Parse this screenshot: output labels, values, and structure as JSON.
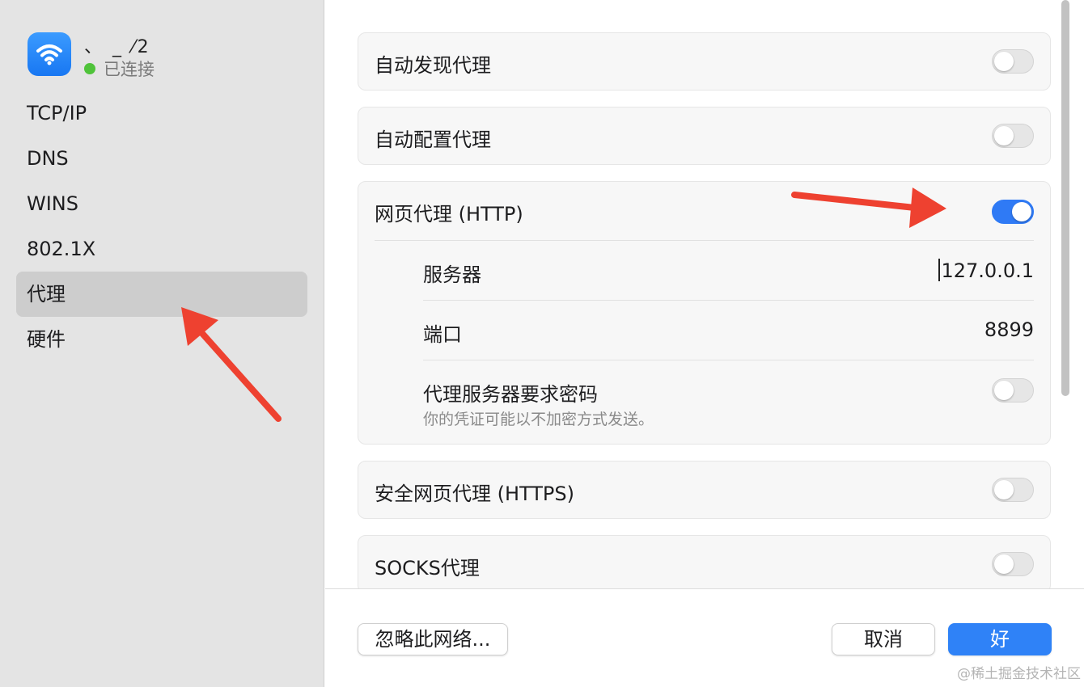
{
  "network": {
    "name": "、 _ ⁄2",
    "status": "已连接"
  },
  "sidebar": {
    "items": [
      {
        "label": "TCP/IP"
      },
      {
        "label": "DNS"
      },
      {
        "label": "WINS"
      },
      {
        "label": "802.1X"
      },
      {
        "label": "代理"
      },
      {
        "label": "硬件"
      }
    ],
    "selected": "代理"
  },
  "proxies": {
    "auto_discovery": {
      "label": "自动发现代理",
      "enabled": false
    },
    "auto_config": {
      "label": "自动配置代理",
      "enabled": false
    },
    "http": {
      "label": "网页代理 (HTTP)",
      "enabled": true,
      "server_label": "服务器",
      "server_value": "127.0.0.1",
      "port_label": "端口",
      "port_value": "8899",
      "auth_label": "代理服务器要求密码",
      "auth_note": "你的凭证可能以不加密方式发送。",
      "auth_enabled": false
    },
    "https": {
      "label": "安全网页代理 (HTTPS)",
      "enabled": false
    },
    "socks": {
      "label": "SOCKS代理",
      "enabled": false
    }
  },
  "footer": {
    "ignore_label": "忽略此网络...",
    "cancel_label": "取消",
    "ok_label": "好"
  },
  "watermark": "@稀土掘金技术社区",
  "colors": {
    "accent": "#2f7af5",
    "status_green": "#4fc33a",
    "annotation_red": "#ee4130"
  },
  "icons": {
    "network": "wifi-icon"
  }
}
